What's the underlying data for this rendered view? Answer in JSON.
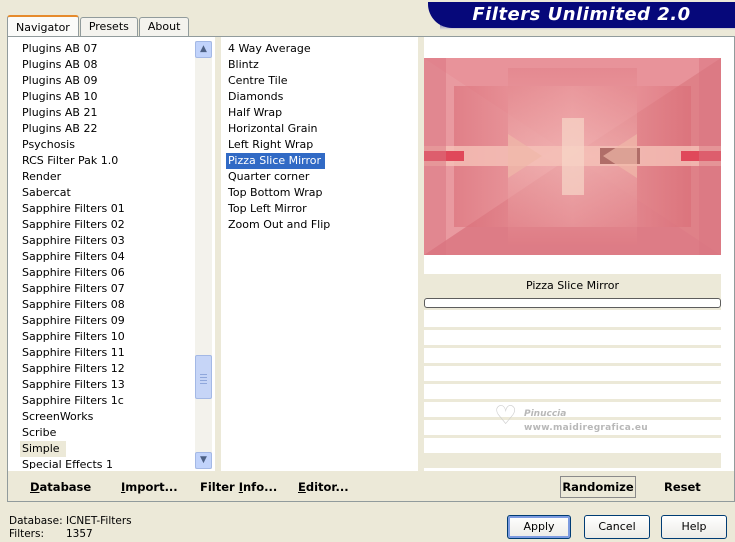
{
  "tabs": [
    {
      "label": "Navigator",
      "active": true
    },
    {
      "label": "Presets",
      "active": false
    },
    {
      "label": "About",
      "active": false
    }
  ],
  "title": "Filters Unlimited 2.0",
  "categories": [
    "Plugins AB 07",
    "Plugins AB 08",
    "Plugins AB 09",
    "Plugins AB 10",
    "Plugins AB 21",
    "Plugins AB 22",
    "Psychosis",
    "RCS Filter Pak 1.0",
    "Render",
    "Sabercat",
    "Sapphire Filters 01",
    "Sapphire Filters 02",
    "Sapphire Filters 03",
    "Sapphire Filters 04",
    "Sapphire Filters 06",
    "Sapphire Filters 07",
    "Sapphire Filters 08",
    "Sapphire Filters 09",
    "Sapphire Filters 10",
    "Sapphire Filters 11",
    "Sapphire Filters 12",
    "Sapphire Filters 13",
    "Sapphire Filters 1c",
    "ScreenWorks",
    "Scribe",
    "Simple",
    "Special Effects 1"
  ],
  "current_category": "Simple",
  "filters": [
    "4 Way Average",
    "Blintz",
    "Centre Tile",
    "Diamonds",
    "Half Wrap",
    "Horizontal Grain",
    "Left Right Wrap",
    "Pizza Slice Mirror",
    "Quarter corner",
    "Top Bottom Wrap",
    "Top Left Mirror",
    "Zoom Out and Flip"
  ],
  "selected_filter": "Pizza Slice Mirror",
  "preview_filter_name": "Pizza Slice Mirror",
  "progress": 0,
  "toolbar": {
    "database_u": "D",
    "database_rest": "atabase",
    "import_u": "I",
    "import_rest": "mport...",
    "filterinfo_a": "Filter ",
    "filterinfo_u": "I",
    "filterinfo_b": "nfo...",
    "editor_u": "E",
    "editor_rest": "ditor...",
    "randomize": "Randomize",
    "reset": "Reset"
  },
  "watermark": {
    "line1": "Pinuccia",
    "line2": "www.maidiregrafica.eu"
  },
  "status": {
    "database_label": "Database:",
    "database_value": "ICNET-Filters",
    "filters_label": "Filters:",
    "filters_value": "1357"
  },
  "buttons": {
    "apply": "Apply",
    "cancel": "Cancel",
    "help": "Help"
  },
  "colors": {
    "banner": "#06087a",
    "selection": "#316ac5",
    "preview_base": "#e58c92"
  }
}
